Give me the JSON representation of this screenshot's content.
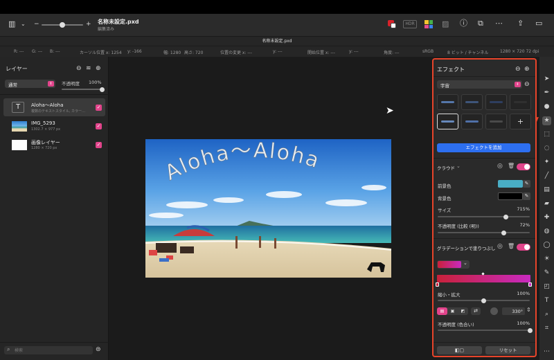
{
  "document": {
    "title": "名称未設定.pxd",
    "subtitle": "編集済み",
    "tab": "名称未設定.pxd"
  },
  "toolbar": {
    "hdr_label": "HDR"
  },
  "info": {
    "r": "R: ---",
    "g": "G: ---",
    "b": "B: ---",
    "cursor_x": "カーソル位置 x: 1254",
    "cursor_y": "y: -166",
    "width": "幅: 1280",
    "height": "高さ: 720",
    "change_x": "位置の変更 x: ---",
    "change_y": "y: ---",
    "start_x": "開始位置 x: ---",
    "start_y": "y: ---",
    "angle": "角度: ---",
    "colorspace": "sRGB",
    "bitdepth": "8 ビット / チャンネル",
    "docsize": "1280 × 720 72 dpi"
  },
  "layers": {
    "title": "レイヤー",
    "blend_mode": "通常",
    "opacity_label": "不透明度",
    "opacity_value": "100%",
    "opacity_fraction": 1.0,
    "items": [
      {
        "name": "Aloha～Aloha",
        "sub": "複数のテキストスタイル, カラー…"
      },
      {
        "name": "IMG_5293",
        "sub": "1302.7 × 977 px"
      },
      {
        "name": "画像レイヤー",
        "sub": "1280 × 720 px"
      }
    ],
    "search_placeholder": "検索"
  },
  "canvas": {
    "text": "Aloha～Aloha"
  },
  "effects": {
    "title": "エフェクト",
    "category": "宇宙",
    "add_button": "エフェクトを追加",
    "cloud": {
      "title": "クラウド",
      "fg_label": "前景色",
      "fg_color": "#49aec5",
      "bg_label": "背景色",
      "bg_color": "#000000",
      "size_label": "サイズ",
      "size_value": "715%",
      "size_fraction": 0.74,
      "opacity_label": "不透明度 (比較 (明))",
      "opacity_value": "72%",
      "opacity_fraction": 0.72
    },
    "gradient": {
      "title": "グラデーションで塗りつぶし",
      "start_color": "#c8213a",
      "end_color": "#c82ac0",
      "scale_label": "縮小・拡大",
      "scale_value": "100%",
      "scale_fraction": 0.5,
      "angle_value": "330°",
      "opacity_label": "不透明度 (色合い)",
      "opacity_value": "100%",
      "opacity_fraction": 1.0
    },
    "reset_button": "リセット"
  },
  "colors": {
    "accent": "#2d6ff0",
    "highlight": "#e8442a",
    "toggle": "#e2448b"
  }
}
